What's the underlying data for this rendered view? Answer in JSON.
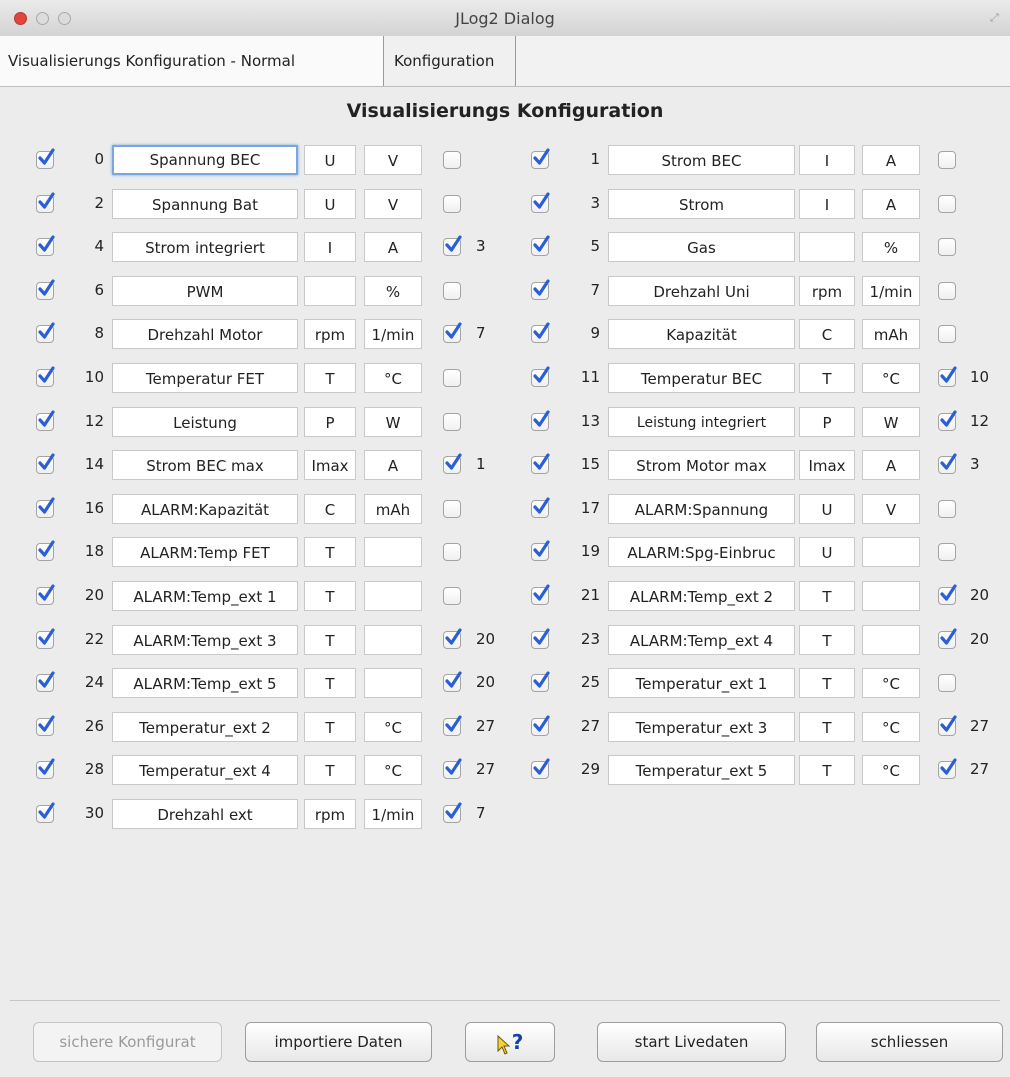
{
  "window": {
    "title": "JLog2 Dialog"
  },
  "tabs": [
    {
      "label": "Visualisierungs Konfiguration - Normal"
    },
    {
      "label": "Konfiguration"
    }
  ],
  "section_title": "Visualisierungs Konfiguration",
  "left_rows": [
    {
      "checked": true,
      "index": "0",
      "name": "Spannung BEC",
      "symbol": "U",
      "unit": "V",
      "linked": false,
      "ref": ""
    },
    {
      "checked": true,
      "index": "2",
      "name": "Spannung Bat",
      "symbol": "U",
      "unit": "V",
      "linked": false,
      "ref": ""
    },
    {
      "checked": true,
      "index": "4",
      "name": "Strom integriert",
      "symbol": "I",
      "unit": "A",
      "linked": true,
      "ref": "3"
    },
    {
      "checked": true,
      "index": "6",
      "name": "PWM",
      "symbol": "",
      "unit": "%",
      "linked": false,
      "ref": ""
    },
    {
      "checked": true,
      "index": "8",
      "name": "Drehzahl Motor",
      "symbol": "rpm",
      "unit": "1/min",
      "linked": true,
      "ref": "7"
    },
    {
      "checked": true,
      "index": "10",
      "name": "Temperatur FET",
      "symbol": "T",
      "unit": "°C",
      "linked": false,
      "ref": ""
    },
    {
      "checked": true,
      "index": "12",
      "name": "Leistung",
      "symbol": "P",
      "unit": "W",
      "linked": false,
      "ref": ""
    },
    {
      "checked": true,
      "index": "14",
      "name": "Strom BEC max",
      "symbol": "Imax",
      "unit": "A",
      "linked": true,
      "ref": "1"
    },
    {
      "checked": true,
      "index": "16",
      "name": "ALARM:Kapazität",
      "symbol": "C",
      "unit": "mAh",
      "linked": false,
      "ref": ""
    },
    {
      "checked": true,
      "index": "18",
      "name": "ALARM:Temp FET",
      "symbol": "T",
      "unit": "",
      "linked": false,
      "ref": ""
    },
    {
      "checked": true,
      "index": "20",
      "name": "ALARM:Temp_ext 1",
      "symbol": "T",
      "unit": "",
      "linked": false,
      "ref": ""
    },
    {
      "checked": true,
      "index": "22",
      "name": "ALARM:Temp_ext 3",
      "symbol": "T",
      "unit": "",
      "linked": true,
      "ref": "20"
    },
    {
      "checked": true,
      "index": "24",
      "name": "ALARM:Temp_ext 5",
      "symbol": "T",
      "unit": "",
      "linked": true,
      "ref": "20"
    },
    {
      "checked": true,
      "index": "26",
      "name": "Temperatur_ext 2",
      "symbol": "T",
      "unit": "°C",
      "linked": true,
      "ref": "27"
    },
    {
      "checked": true,
      "index": "28",
      "name": "Temperatur_ext 4",
      "symbol": "T",
      "unit": "°C",
      "linked": true,
      "ref": "27"
    },
    {
      "checked": true,
      "index": "30",
      "name": "Drehzahl ext",
      "symbol": "rpm",
      "unit": "1/min",
      "linked": true,
      "ref": "7"
    }
  ],
  "right_rows": [
    {
      "checked": true,
      "index": "1",
      "name": "Strom BEC",
      "symbol": "I",
      "unit": "A",
      "linked": false,
      "ref": ""
    },
    {
      "checked": true,
      "index": "3",
      "name": "Strom",
      "symbol": "I",
      "unit": "A",
      "linked": false,
      "ref": ""
    },
    {
      "checked": true,
      "index": "5",
      "name": "Gas",
      "symbol": "",
      "unit": "%",
      "linked": false,
      "ref": ""
    },
    {
      "checked": true,
      "index": "7",
      "name": "Drehzahl Uni",
      "symbol": "rpm",
      "unit": "1/min",
      "linked": false,
      "ref": ""
    },
    {
      "checked": true,
      "index": "9",
      "name": "Kapazität",
      "symbol": "C",
      "unit": "mAh",
      "linked": false,
      "ref": ""
    },
    {
      "checked": true,
      "index": "11",
      "name": "Temperatur BEC",
      "symbol": "T",
      "unit": "°C",
      "linked": true,
      "ref": "10"
    },
    {
      "checked": true,
      "index": "13",
      "name": "Leistung integriert",
      "symbol": "P",
      "unit": "W",
      "linked": true,
      "ref": "12"
    },
    {
      "checked": true,
      "index": "15",
      "name": "Strom Motor max",
      "symbol": "Imax",
      "unit": "A",
      "linked": true,
      "ref": "3"
    },
    {
      "checked": true,
      "index": "17",
      "name": "ALARM:Spannung",
      "symbol": "U",
      "unit": "V",
      "linked": false,
      "ref": ""
    },
    {
      "checked": true,
      "index": "19",
      "name": "ALARM:Spg-Einbruc",
      "symbol": "U",
      "unit": "",
      "linked": false,
      "ref": ""
    },
    {
      "checked": true,
      "index": "21",
      "name": "ALARM:Temp_ext 2",
      "symbol": "T",
      "unit": "",
      "linked": true,
      "ref": "20"
    },
    {
      "checked": true,
      "index": "23",
      "name": "ALARM:Temp_ext 4",
      "symbol": "T",
      "unit": "",
      "linked": true,
      "ref": "20"
    },
    {
      "checked": true,
      "index": "25",
      "name": "Temperatur_ext 1",
      "symbol": "T",
      "unit": "°C",
      "linked": false,
      "ref": ""
    },
    {
      "checked": true,
      "index": "27",
      "name": "Temperatur_ext 3",
      "symbol": "T",
      "unit": "°C",
      "linked": true,
      "ref": "27"
    },
    {
      "checked": true,
      "index": "29",
      "name": "Temperatur_ext 5",
      "symbol": "T",
      "unit": "°C",
      "linked": true,
      "ref": "27"
    }
  ],
  "buttons": {
    "save": "sichere Konfigurat",
    "import": "importiere Daten",
    "help_glyph": "?",
    "live": "start Livedaten",
    "close": "schliessen"
  },
  "colors": {
    "checkmark": "#2a5fd6",
    "focus_ring": "#7aa7df",
    "close_light": "#e2453c"
  },
  "icons": {
    "help": "context-help-arrow-question-icon",
    "resize": "resize-corner-icon"
  }
}
